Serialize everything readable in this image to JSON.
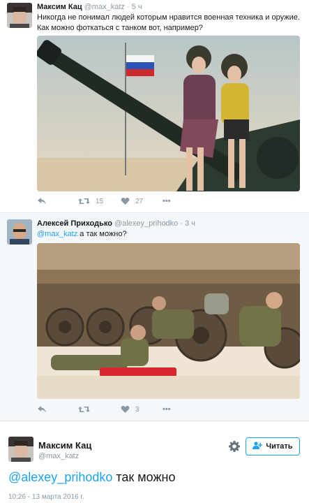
{
  "tweet1": {
    "name": "Максим Кац",
    "handle": "@max_katz",
    "separator": "·",
    "time": "5 ч",
    "text_line1": "Никогда не понимал людей которым нравится военная техника и оружие.",
    "text_line2": "Как можно фоткаться с танком вот, например?",
    "retweets": "15",
    "likes": "27",
    "more": "•••"
  },
  "tweet2": {
    "name": "Алексей Приходько",
    "handle": "@alexey_prihodko",
    "separator": "·",
    "time": "3 ч",
    "mention": "@max_katz",
    "text": " а так можно?",
    "likes": "3",
    "more": "•••"
  },
  "tweet3": {
    "name": "Максим Кац",
    "handle": "@max_katz",
    "follow_label": "Читать",
    "mention": "@alexey_prihodko",
    "text": " так можно",
    "timestamp": "10:26 - 13 марта 2016 г."
  },
  "icons": {
    "reply": "reply-icon",
    "retweet": "retweet-icon",
    "like": "heart-icon",
    "more": "more-icon",
    "gear": "gear-icon",
    "follow": "add-user-icon"
  },
  "colors": {
    "accent": "#1da1f2",
    "secondary_text": "#8899a6",
    "primary_text": "#14171a",
    "divider": "#e1e8ed"
  }
}
